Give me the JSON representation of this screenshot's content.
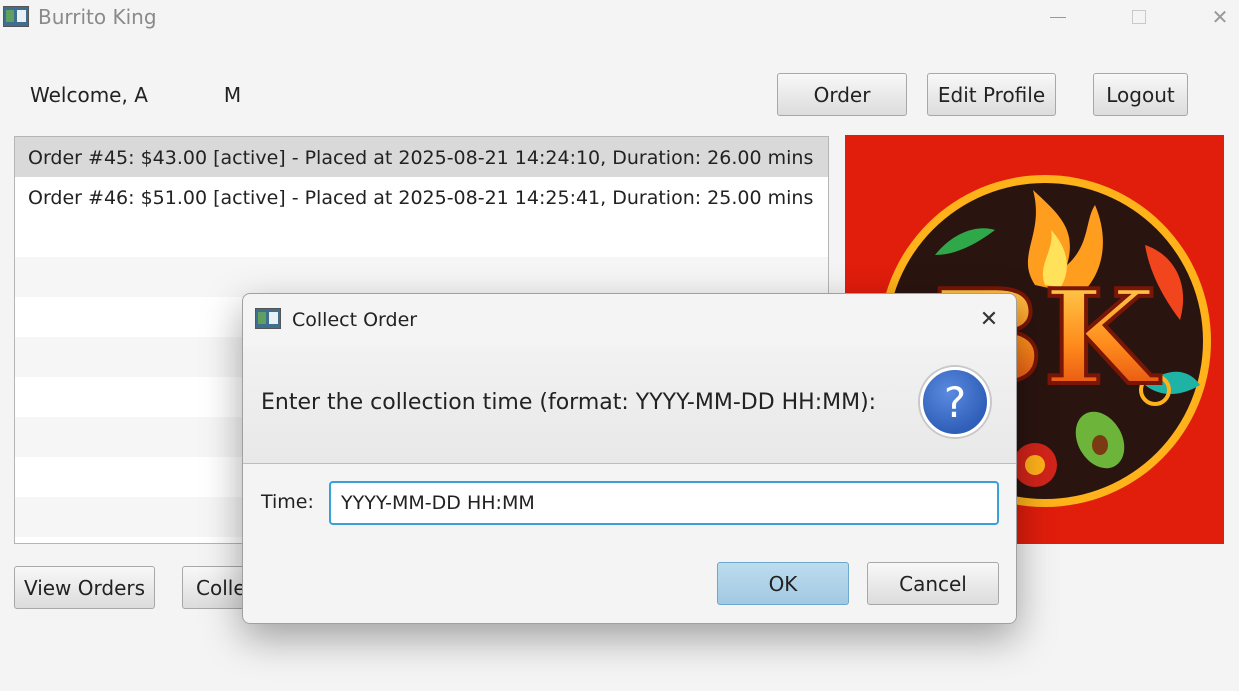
{
  "window": {
    "title": "Burrito King"
  },
  "header": {
    "welcome_label": "Welcome, A",
    "welcome_surname": "M",
    "order_button": "Order",
    "edit_profile_button": "Edit Profile",
    "logout_button": "Logout"
  },
  "orders": [
    "Order #45: $43.00 [active] - Placed at 2025-08-21 14:24:10, Duration: 26.00 mins",
    "Order #46: $51.00 [active] - Placed at 2025-08-21 14:25:41, Duration: 25.00 mins"
  ],
  "bottom": {
    "view_orders_button": "View Orders",
    "collect_button_partial": "Colle"
  },
  "logo": {
    "text": "BK"
  },
  "dialog": {
    "title": "Collect Order",
    "message": "Enter the collection time (format: YYYY-MM-DD HH:MM):",
    "time_label": "Time:",
    "time_value": "YYYY-MM-DD HH:MM",
    "ok_button": "OK",
    "cancel_button": "Cancel",
    "icon": "question-icon"
  },
  "colors": {
    "accent": "#3aa0d8",
    "ok_button": "#a9cfe6",
    "logo_bg": "#e11d0c"
  }
}
